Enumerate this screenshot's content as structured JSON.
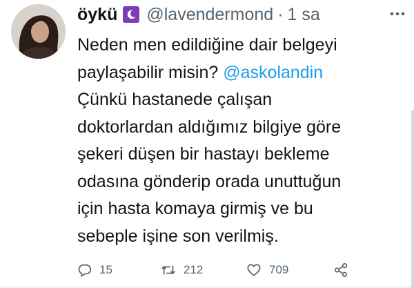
{
  "tweet": {
    "author": {
      "display_name": "öykü",
      "badge_icon": "crescent-moon-emoji",
      "handle": "@lavendermond",
      "separator": "·",
      "time": "1 sa"
    },
    "text_lines": [
      "Neden men edildiğine dair belgeyi",
      "paylaşabilir misin? ",
      "Çünkü hastanede çalışan",
      "doktorlardan aldığımız bilgiye göre",
      "şekeri düşen bir hastayı bekleme",
      "odasına gönderip orada unuttuğun",
      "için hasta komaya girmiş ve bu",
      "sebeple işine son verilmiş."
    ],
    "mention": "@askolandin",
    "mention_color": "#1d9bf0",
    "actions": {
      "reply_count": "15",
      "retweet_count": "212",
      "like_count": "709"
    }
  }
}
